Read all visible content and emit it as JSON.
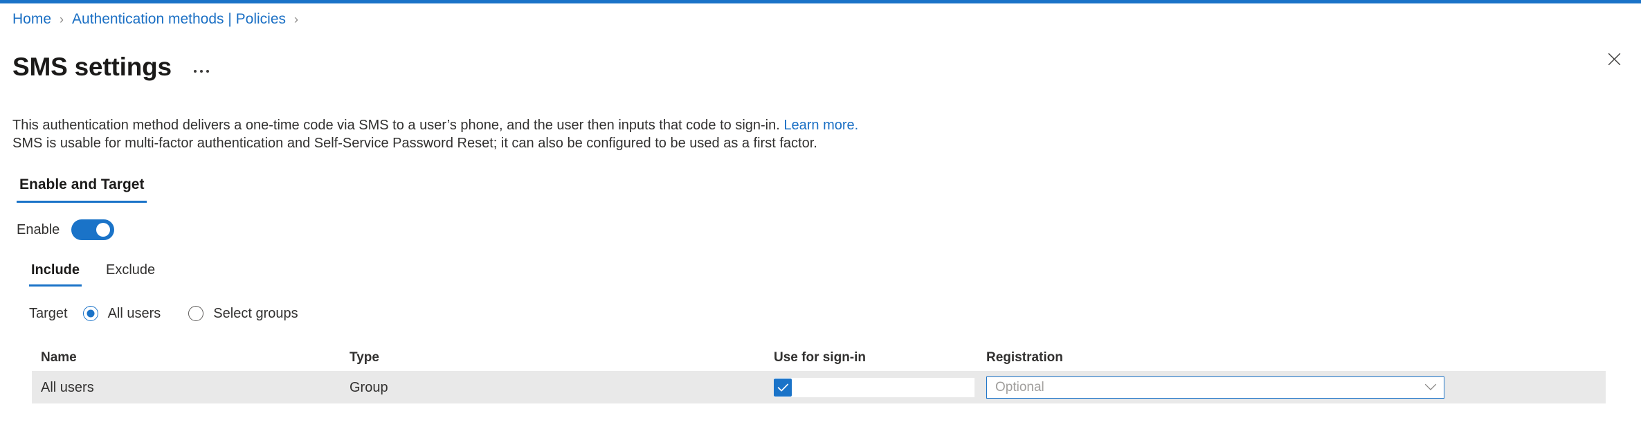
{
  "theme": {
    "accent": "#1a73c8",
    "link": "#1a6fc4",
    "row_bg": "#e9e9e9",
    "text": "#323130",
    "placeholder": "#a19f9d"
  },
  "breadcrumb": {
    "items": [
      {
        "label": "Home"
      },
      {
        "label": "Authentication methods | Policies"
      }
    ],
    "separator": "›"
  },
  "header": {
    "title": "SMS settings",
    "more_menu": "…",
    "close": "Close"
  },
  "description": {
    "line1_before_link": "This authentication method delivers a one-time code via SMS to a user’s phone, and the user then inputs that code to sign-in. ",
    "link_text": "Learn more.",
    "line2": "SMS is usable for multi-factor authentication and Self-Service Password Reset; it can also be configured to be used as a first factor."
  },
  "primary_tabs": [
    {
      "label": "Enable and Target",
      "active": true
    }
  ],
  "enable": {
    "label": "Enable",
    "state": "on"
  },
  "sub_tabs": [
    {
      "label": "Include",
      "active": true
    },
    {
      "label": "Exclude",
      "active": false
    }
  ],
  "target": {
    "label": "Target",
    "options": [
      {
        "label": "All users",
        "selected": true
      },
      {
        "label": "Select groups",
        "selected": false
      }
    ]
  },
  "table": {
    "columns": [
      "Name",
      "Type",
      "Use for sign-in",
      "Registration"
    ],
    "rows": [
      {
        "name": "All users",
        "type": "Group",
        "use_for_signin": true,
        "registration_value": "Optional"
      }
    ]
  }
}
